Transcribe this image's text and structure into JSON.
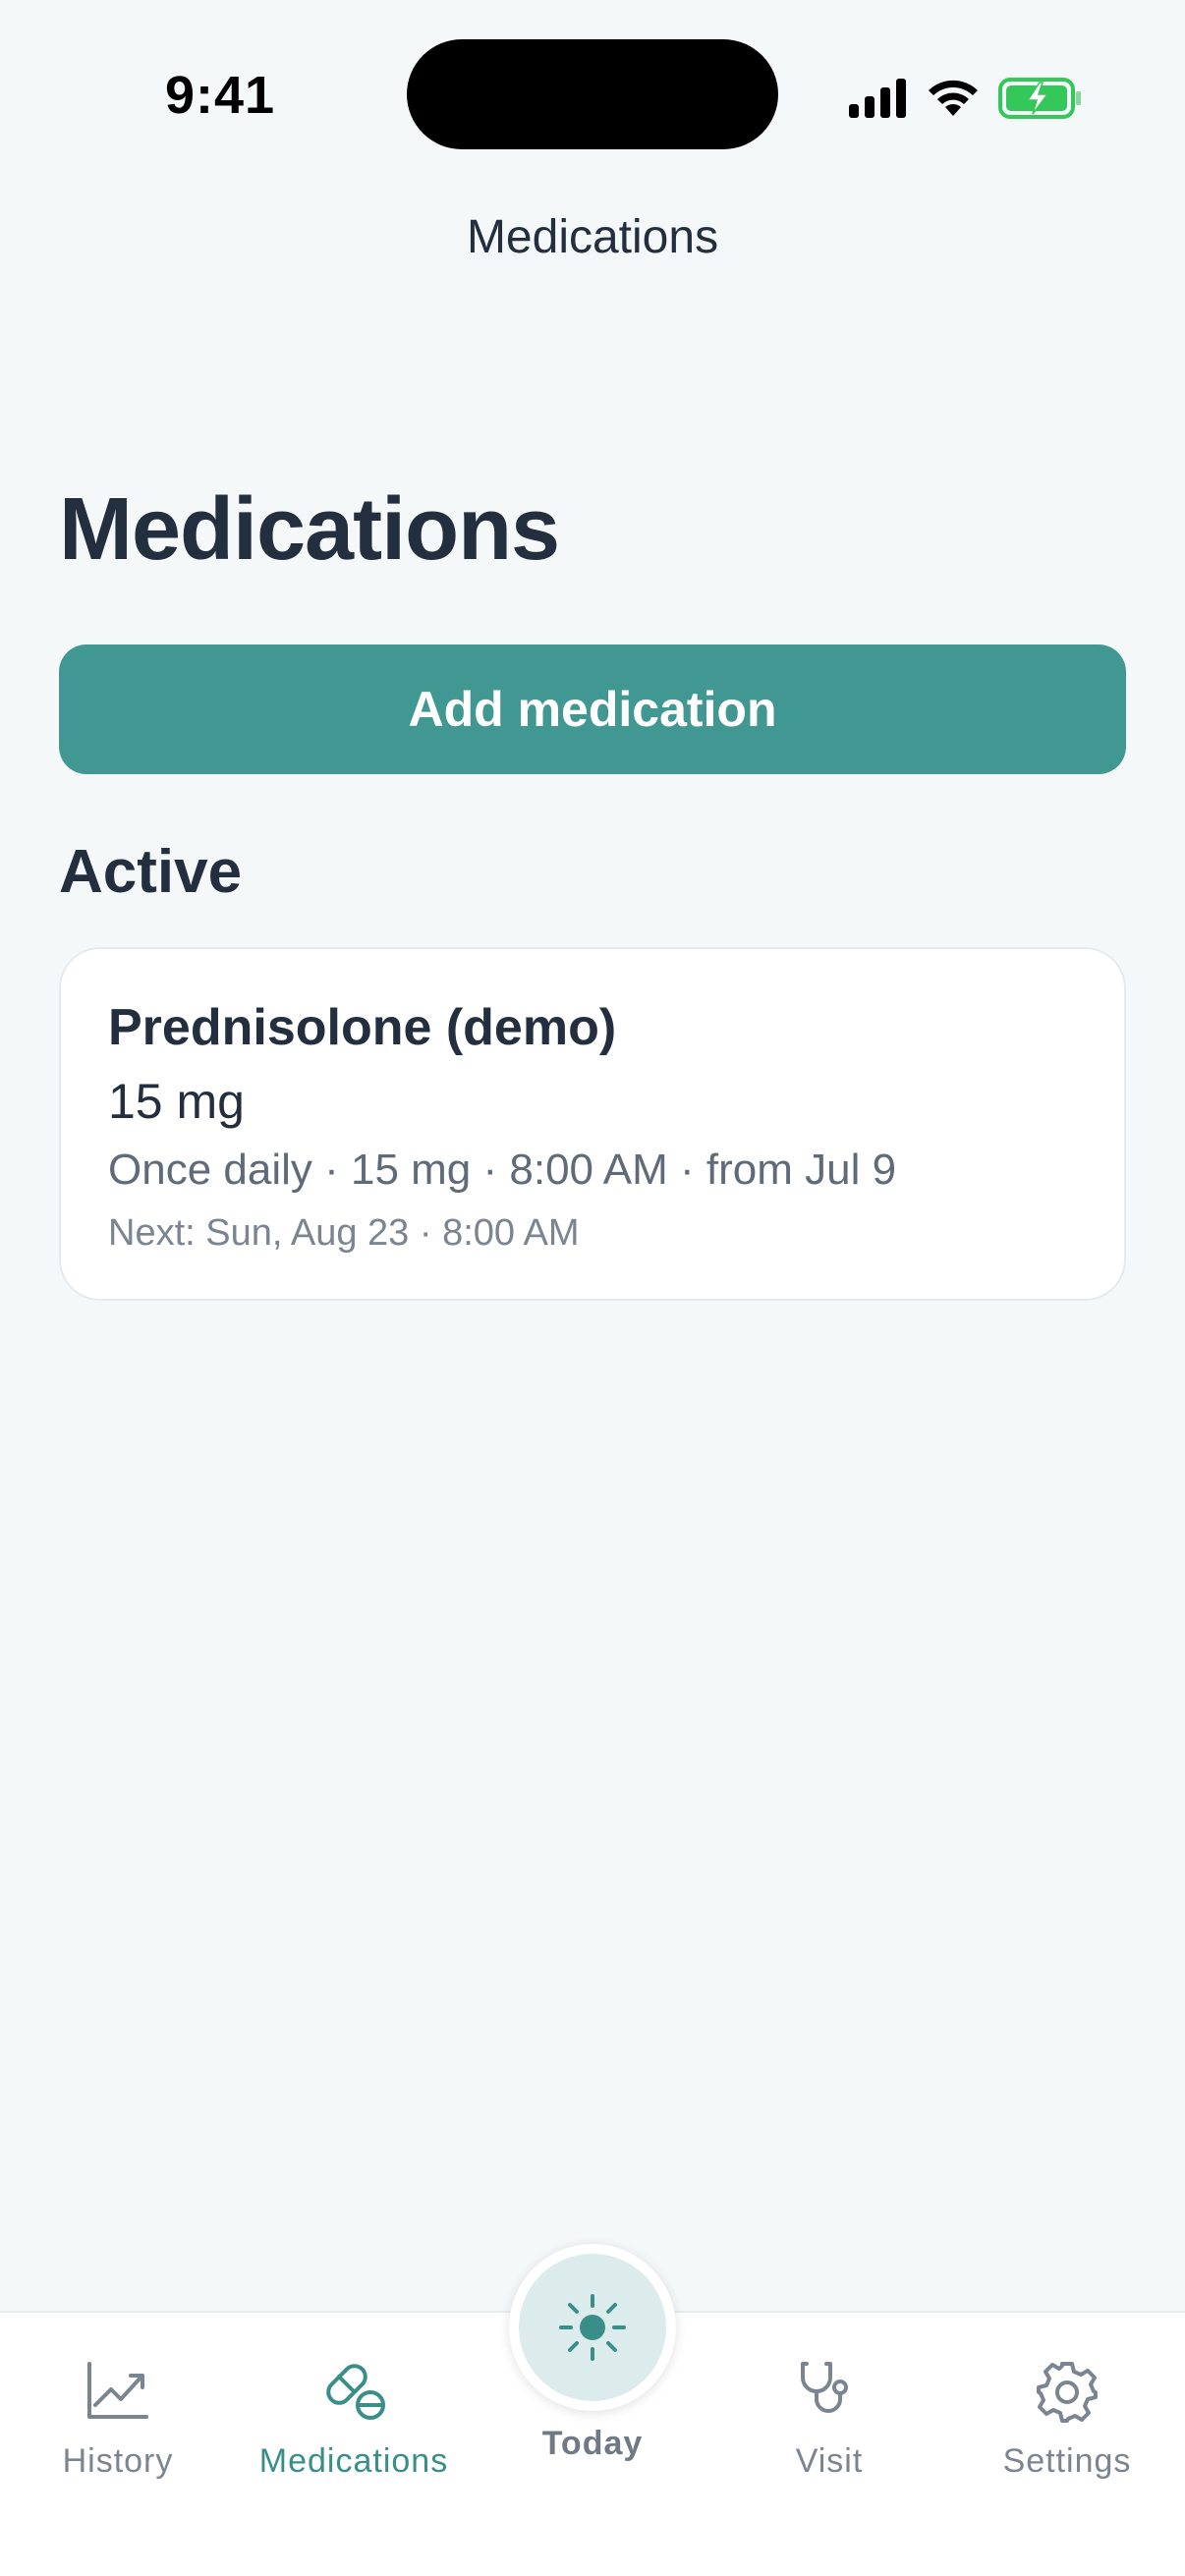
{
  "status_bar": {
    "time": "9:41"
  },
  "nav": {
    "title": "Medications"
  },
  "page": {
    "title": "Medications"
  },
  "actions": {
    "add_label": "Add medication"
  },
  "section": {
    "active_heading": "Active"
  },
  "medications": [
    {
      "name": "Prednisolone (demo)",
      "dose": "15 mg",
      "schedule": "Once daily · 15 mg · 8:00 AM · from Jul 9",
      "next": "Next: Sun, Aug 23 · 8:00 AM"
    }
  ],
  "tabs": [
    {
      "label": "History",
      "icon": "chart-line-icon",
      "active": false
    },
    {
      "label": "Medications",
      "icon": "pill-icon",
      "active": true
    },
    {
      "label": "Today",
      "icon": "sun-icon",
      "active": false
    },
    {
      "label": "Visit",
      "icon": "stethoscope-icon",
      "active": false
    },
    {
      "label": "Settings",
      "icon": "gear-icon",
      "active": false
    }
  ],
  "colors": {
    "accent": "#419792",
    "background": "#f4f8f9",
    "text": "#232f3e",
    "battery": "#34c759"
  }
}
